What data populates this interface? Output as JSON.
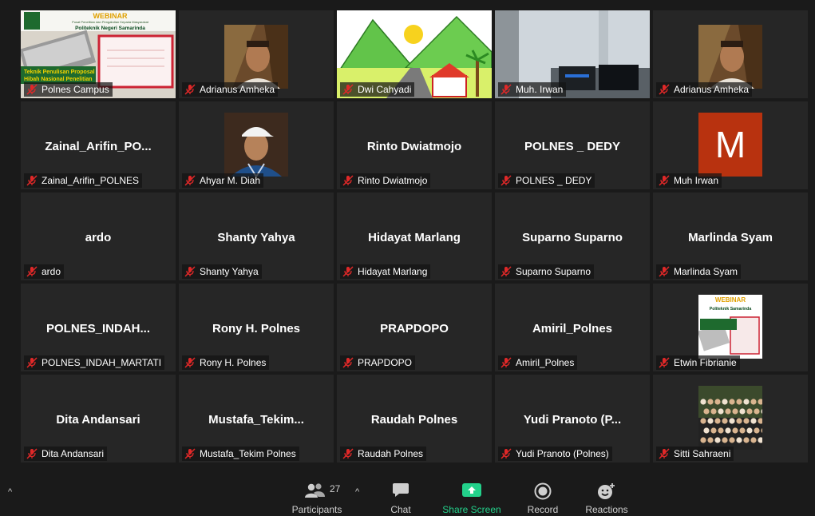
{
  "webinar": {
    "title": "WEBINAR",
    "subtitle": "Pusat Penelitian dan Pengabdian Kepada Masyarakat",
    "school": "Politeknik Negeri Samarinda",
    "topic_line1": "Teknik Penulisan Proposal",
    "topic_line2": "Hibah Nasional Penelitian"
  },
  "tiles": [
    {
      "name": "Polnes Campus",
      "display": "",
      "type": "webinar",
      "active": true
    },
    {
      "name": "Adrianus Amheka",
      "display": "",
      "type": "thumb-person"
    },
    {
      "name": "Dwi Cahyadi",
      "display": "",
      "type": "drawing"
    },
    {
      "name": "Muh. Irwan",
      "display": "",
      "type": "room"
    },
    {
      "name": "Adrianus Amheka",
      "display": "",
      "type": "thumb-person"
    },
    {
      "name": "Zainal_Arifin_POLNES",
      "display": "Zainal_Arifin_PO...",
      "type": "text"
    },
    {
      "name": "Ahyar M. Diah",
      "display": "",
      "type": "thumb-cap"
    },
    {
      "name": "Rinto Dwiatmojo",
      "display": "Rinto Dwiatmojo",
      "type": "text"
    },
    {
      "name": "POLNES _ DEDY",
      "display": "POLNES _ DEDY",
      "type": "text"
    },
    {
      "name": "Muh Irwan",
      "display": "",
      "type": "letter",
      "letter": "M"
    },
    {
      "name": "ardo",
      "display": "ardo",
      "type": "text"
    },
    {
      "name": "Shanty Yahya",
      "display": "Shanty Yahya",
      "type": "text"
    },
    {
      "name": "Hidayat Marlang",
      "display": "Hidayat Marlang",
      "type": "text"
    },
    {
      "name": "Suparno Suparno",
      "display": "Suparno Suparno",
      "type": "text"
    },
    {
      "name": "Marlinda Syam",
      "display": "Marlinda Syam",
      "type": "text"
    },
    {
      "name": "POLNES_INDAH_MARTATI",
      "display": "POLNES_INDAH...",
      "type": "text"
    },
    {
      "name": "Rony H. Polnes",
      "display": "Rony H. Polnes",
      "type": "text"
    },
    {
      "name": "PRAPDOPO",
      "display": "PRAPDOPO",
      "type": "text"
    },
    {
      "name": "Amiril_Polnes",
      "display": "Amiril_Polnes",
      "type": "text"
    },
    {
      "name": "Etwin Fibrianie",
      "display": "",
      "type": "thumb-webinar",
      "w_title": "WEBINAR",
      "w_school": "Politeknik Samarinda"
    },
    {
      "name": "Dita Andansari",
      "display": "Dita Andansari",
      "type": "text"
    },
    {
      "name": "Mustafa_Tekim Polnes",
      "display": "Mustafa_Tekim...",
      "type": "text"
    },
    {
      "name": "Raudah Polnes",
      "display": "Raudah Polnes",
      "type": "text"
    },
    {
      "name": "Yudi Pranoto (Polnes)",
      "display": "Yudi Pranoto (P...",
      "type": "text"
    },
    {
      "name": "Sitti Sahraeni",
      "display": "",
      "type": "thumb-group"
    }
  ],
  "toolbar": {
    "participants_label": "Participants",
    "participants_count": "27",
    "chat_label": "Chat",
    "share_label": "Share Screen",
    "record_label": "Record",
    "reactions_label": "Reactions",
    "left_caret": "^",
    "participants_caret": "^"
  },
  "colors": {
    "background": "#1a1a1a",
    "tile": "#262626",
    "active_speaker": "#c7d91e",
    "share_green": "#23d18b",
    "mute_red": "#e02828",
    "avatar_orange": "#b8320f"
  }
}
